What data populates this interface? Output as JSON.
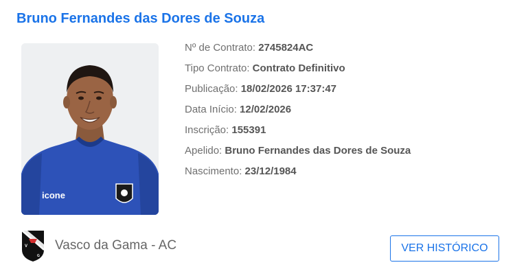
{
  "player": {
    "name": "Bruno Fernandes das Dores de Souza",
    "photo_alt": "player-photo"
  },
  "details": [
    {
      "label": "Nº de Contrato: ",
      "value": "2745824AC"
    },
    {
      "label": "Tipo Contrato: ",
      "value": "Contrato Definitivo"
    },
    {
      "label": "Publicação: ",
      "value": "18/02/2026 17:37:47"
    },
    {
      "label": "Data Início: ",
      "value": "12/02/2026"
    },
    {
      "label": "Inscrição: ",
      "value": "155391"
    },
    {
      "label": "Apelido: ",
      "value": "Bruno Fernandes das Dores de Souza"
    },
    {
      "label": "Nascimento: ",
      "value": "23/12/1984"
    }
  ],
  "club": {
    "name": "Vasco da Gama - AC",
    "crest_icon": "club-crest-icon"
  },
  "actions": {
    "history_label": "VER HISTÓRICO"
  },
  "colors": {
    "accent": "#1a73e8",
    "text": "#666666",
    "jersey": "#2d52b8"
  }
}
